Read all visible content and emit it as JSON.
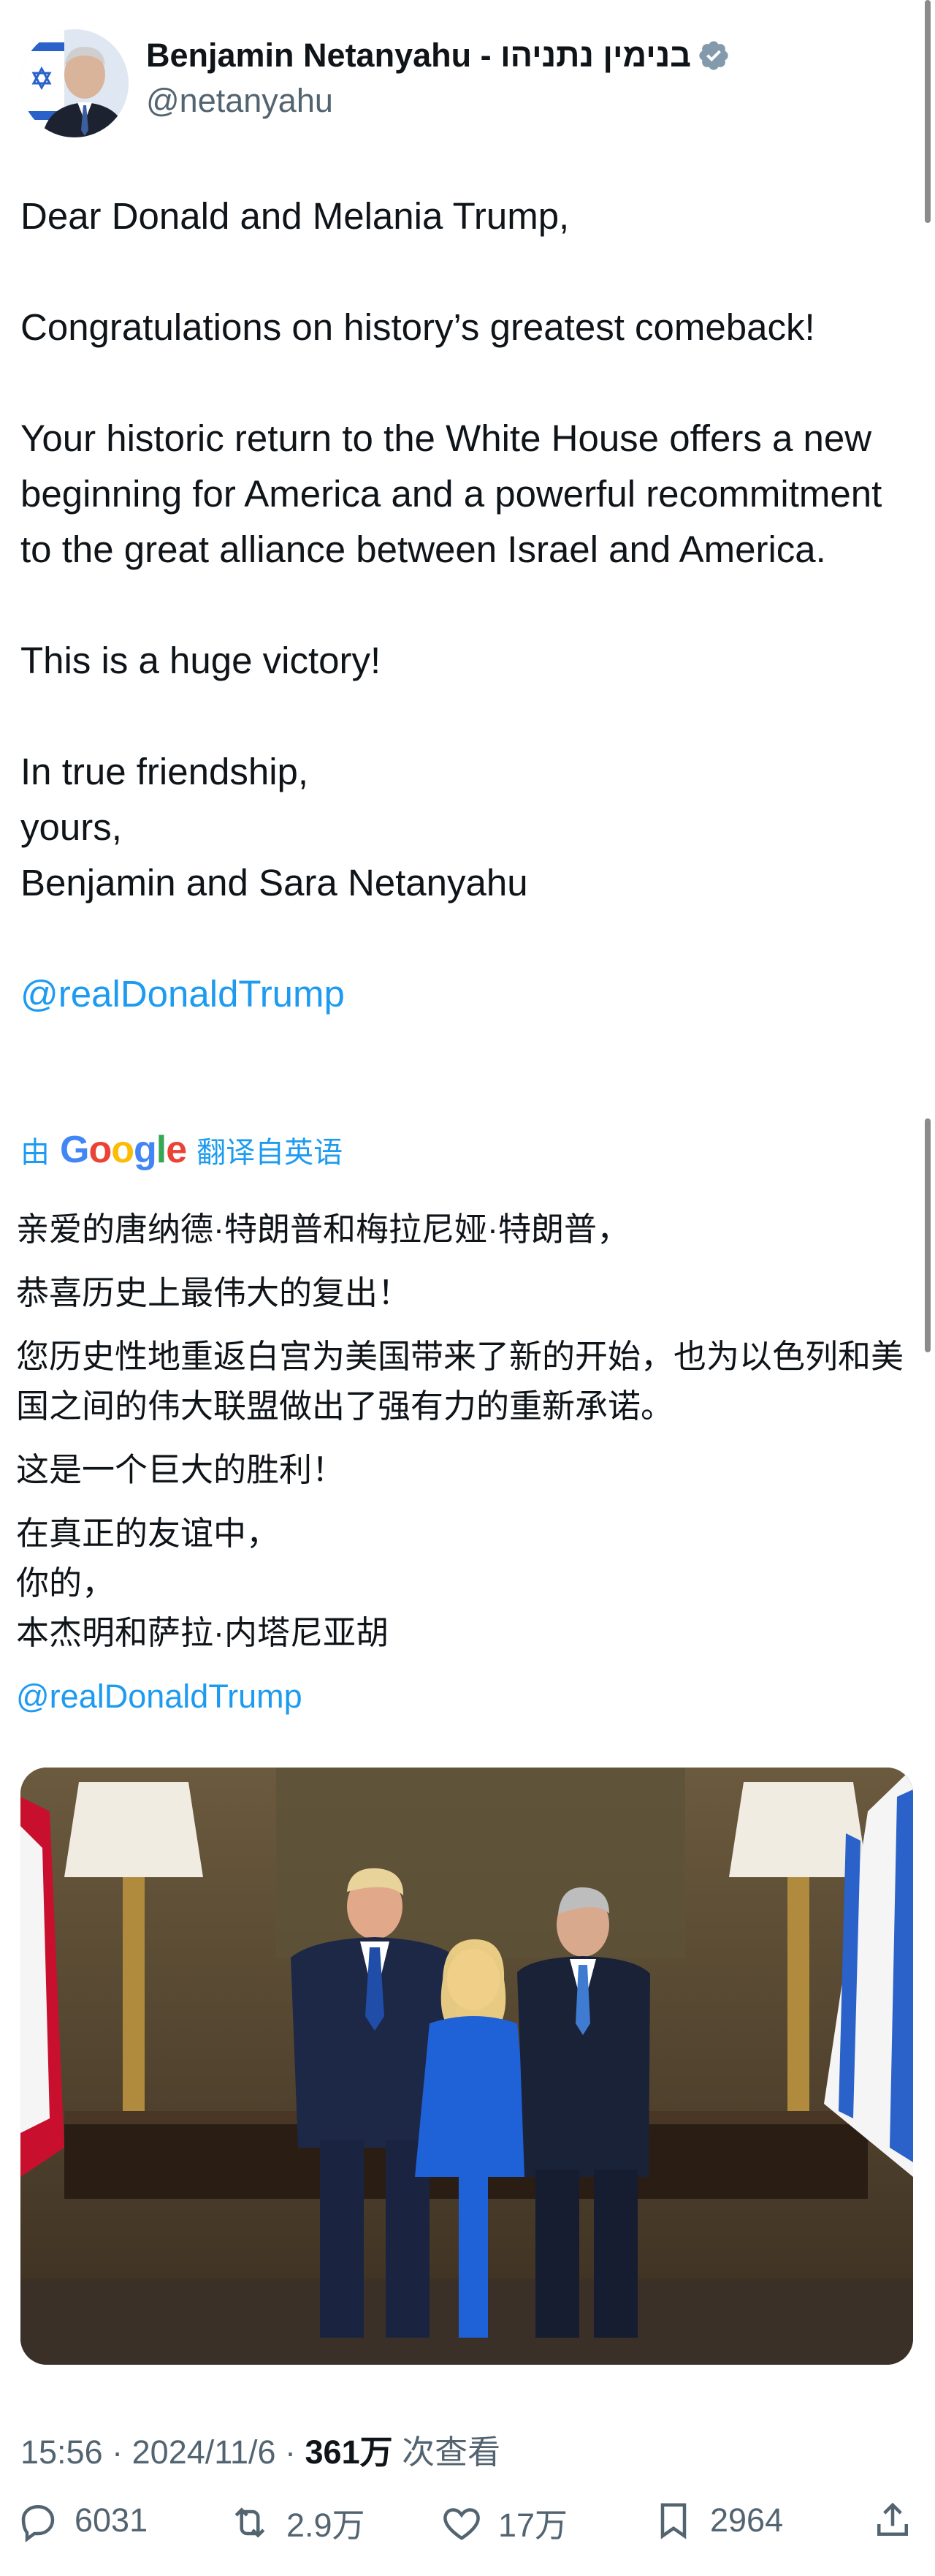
{
  "author": {
    "display_name": "Benjamin Netanyahu - בנימין נתניהו",
    "handle": "@netanyahu",
    "verified": true
  },
  "tweet": {
    "lines": [
      "Dear Donald and Melania Trump,",
      "Congratulations on history’s greatest comeback!",
      "Your historic return to the White House offers a new beginning for America and a powerful recommitment to the great alliance between Israel and America.",
      "This is a huge victory!",
      "In true friendship,",
      "yours,",
      "Benjamin and Sara Netanyahu",
      "@realDonaldTrump"
    ]
  },
  "translation": {
    "prefix": "由",
    "provider": "Google",
    "suffix": "翻译自英语",
    "lines": [
      "亲爱的唐纳德·特朗普和梅拉尼娅·特朗普，",
      "恭喜历史上最伟大的复出！",
      "您历史性地重返白宫为美国带来了新的开始，也为以色列和美国之间的伟大联盟做出了强有力的重新承诺。",
      "这是一个巨大的胜利！",
      "在真正的友谊中，",
      "你的，",
      "本杰明和萨拉·内塔尼亚胡",
      "@realDonaldTrump"
    ]
  },
  "meta": {
    "time": "15:56",
    "date": "2024/11/6",
    "views": "361万",
    "views_label": "次查看"
  },
  "actions": {
    "replies": "6031",
    "retweets": "2.9万",
    "likes": "17万",
    "bookmarks": "2964"
  },
  "colors": {
    "accent": "#1d9bf0",
    "text": "#0f1419",
    "muted": "#536471"
  }
}
